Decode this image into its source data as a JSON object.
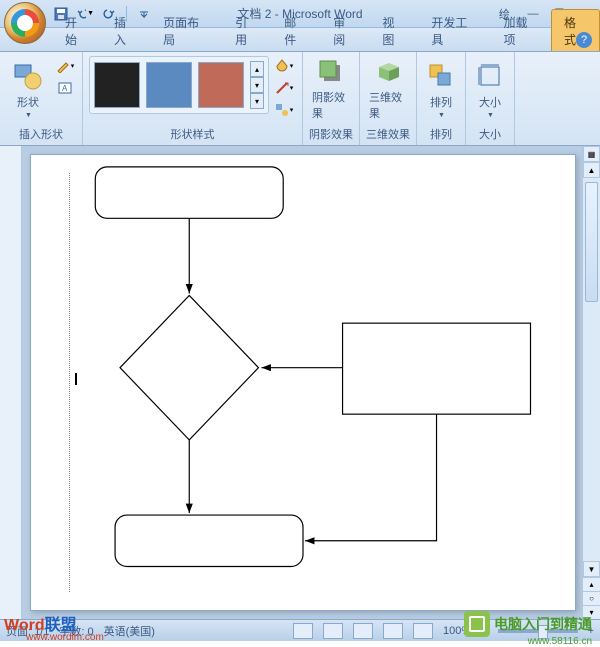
{
  "title": "文档 2 - Microsoft Word",
  "context_tab": "绘..",
  "tabs": {
    "home": "开始",
    "insert": "插入",
    "layout": "页面布局",
    "references": "引用",
    "mail": "邮件",
    "review": "审阅",
    "view": "视图",
    "developer": "开发工具",
    "addins": "加载项",
    "format": "格式"
  },
  "ribbon": {
    "insert_shapes": {
      "label": "插入形状",
      "shape_btn": "形状"
    },
    "shape_styles": {
      "label": "形状样式"
    },
    "shadow": {
      "label": "阴影效果"
    },
    "threeD": {
      "label": "三维效果"
    },
    "arrange": {
      "label": "排列"
    },
    "size": {
      "label": "大小"
    }
  },
  "status": {
    "page": "页面: 1/1",
    "words": "字数: 0",
    "lang": "英语(美国)",
    "zoom": "100%"
  },
  "watermarks": {
    "w1a": "Word",
    "w1b": "联盟",
    "w1url": "www.wordlm.com",
    "w2": "电脑入门到精通",
    "w2url": "www.58116.cn"
  }
}
